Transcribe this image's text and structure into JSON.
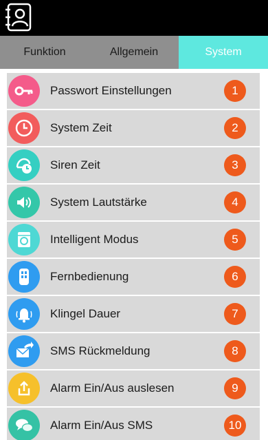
{
  "header": {
    "app_icon": "contacts-book-icon"
  },
  "tabs": [
    {
      "label": "Funktion",
      "active": false
    },
    {
      "label": "Allgemein",
      "active": false
    },
    {
      "label": "System",
      "active": true
    }
  ],
  "accent_color": "#5ee8df",
  "badge_color": "#ee5a1c",
  "items": [
    {
      "label": "Passwort Einstellungen",
      "number": "1",
      "icon": "key-icon",
      "icon_color": "#f45b8a"
    },
    {
      "label": "System Zeit",
      "number": "2",
      "icon": "clock-icon",
      "icon_color": "#f25c5c"
    },
    {
      "label": "Siren Zeit",
      "number": "3",
      "icon": "alarm-clock-icon",
      "icon_color": "#35cfc2"
    },
    {
      "label": "System Lautstärke",
      "number": "4",
      "icon": "speaker-icon",
      "icon_color": "#34c7a9"
    },
    {
      "label": "Intelligent Modus",
      "number": "5",
      "icon": "washing-machine-icon",
      "icon_color": "#4ed8d4"
    },
    {
      "label": "Fernbedienung",
      "number": "6",
      "icon": "remote-control-icon",
      "icon_color": "#2f9cf0"
    },
    {
      "label": "Klingel Dauer",
      "number": "7",
      "icon": "bell-icon",
      "icon_color": "#2f9cf0"
    },
    {
      "label": "SMS Rückmeldung",
      "number": "8",
      "icon": "mail-forward-icon",
      "icon_color": "#2f9cf0"
    },
    {
      "label": "Alarm Ein/Aus auslesen",
      "number": "9",
      "icon": "upload-icon",
      "icon_color": "#f6c02b"
    },
    {
      "label": "Alarm Ein/Aus SMS",
      "number": "10",
      "icon": "chat-bubbles-icon",
      "icon_color": "#35c2a5"
    }
  ]
}
